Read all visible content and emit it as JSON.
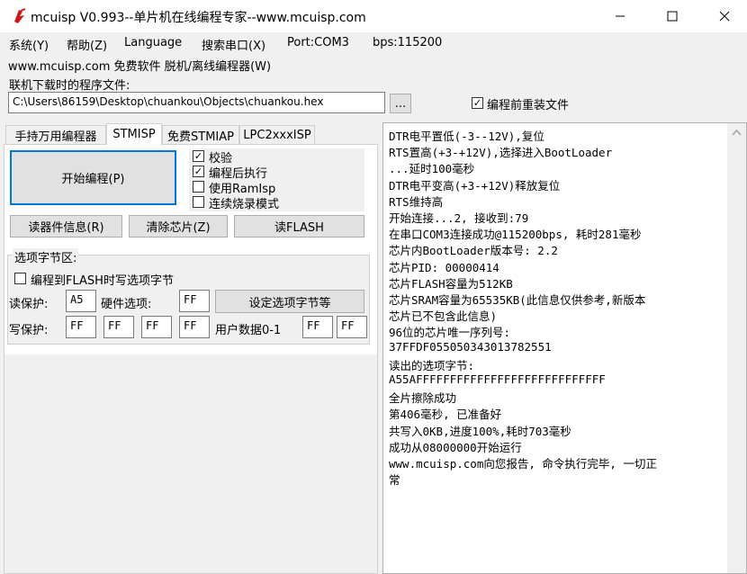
{
  "window": {
    "title": "mcuisp V0.993--单片机在线编程专家--www.mcuisp.com"
  },
  "menu": {
    "items": [
      "系统(Y)",
      "帮助(Z)",
      "Language",
      "搜索串口(X)",
      "Port:COM3",
      "bps:115200"
    ],
    "line2": "www.mcuisp.com 免费软件 脱机/离线编程器(W)"
  },
  "file": {
    "label": "联机下载时的程序文件:",
    "path": "C:\\Users\\86159\\Desktop\\chuankou\\Objects\\chuankou.hex",
    "browse": "...",
    "reload_label": "编程前重装文件",
    "reload_checked": true
  },
  "tabs": [
    "手持万用编程器",
    "STMISP",
    "免费STMIAP",
    "LPC2xxxISP"
  ],
  "stmisp": {
    "start_button": "开始编程(P)",
    "options": [
      {
        "label": "校验",
        "checked": true
      },
      {
        "label": "编程后执行",
        "checked": true
      },
      {
        "label": "使用RamIsp",
        "checked": false
      },
      {
        "label": "连续烧录模式",
        "checked": false
      }
    ],
    "read_info": "读器件信息(R)",
    "erase_chip": "清除芯片(Z)",
    "read_flash": "读FLASH",
    "option_group": "选项字节区:",
    "write_option_flash": "编程到FLASH时写选项字节",
    "read_protect_label": "读保护:",
    "read_protect_value": "A5",
    "hw_option_label": "硬件选项:",
    "hw_option_value": "FF",
    "set_option_button": "设定选项字节等",
    "write_protect_label": "写保护:",
    "write_protect_values": [
      "FF",
      "FF",
      "FF",
      "FF"
    ],
    "user_data_label": "用户数据0-1",
    "user_data_values": [
      "FF",
      "FF"
    ]
  },
  "log": [
    "DTR电平置低(-3--12V),复位",
    "RTS置高(+3-+12V),选择进入BootLoader",
    "...延时100毫秒",
    "DTR电平变高(+3-+12V)释放复位",
    "RTS维持高",
    "开始连接...2, 接收到:79",
    "在串口COM3连接成功@115200bps, 耗时281毫秒",
    "芯片内BootLoader版本号: 2.2",
    "芯片PID: 00000414",
    "芯片FLASH容量为512KB",
    "芯片SRAM容量为65535KB(此信息仅供参考,新版本",
    "芯片已不包含此信息)",
    "96位的芯片唯一序列号:",
    "37FFDF055050343013782551",
    "读出的选项字节:",
    "A55AFFFFFFFFFFFFFFFFFFFFFFFFFFFF",
    "全片擦除成功",
    "第406毫秒, 已准备好",
    "共写入0KB,进度100%,耗时703毫秒",
    "成功从08000000开始运行",
    "www.mcuisp.com向您报告, 命令执行完毕, 一切正",
    "常"
  ]
}
